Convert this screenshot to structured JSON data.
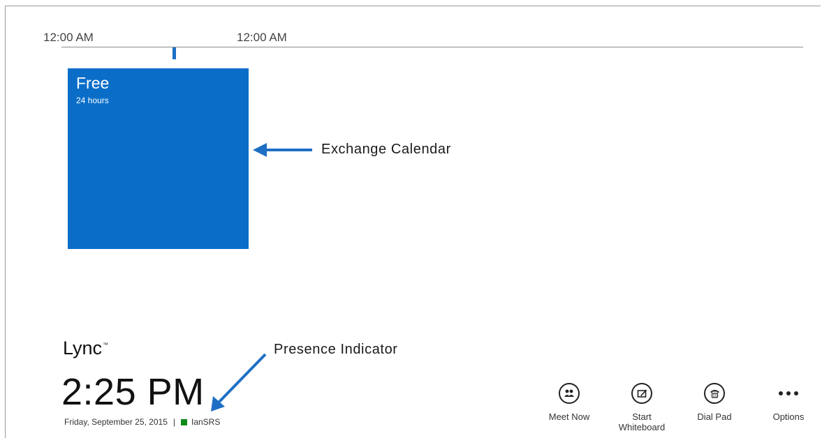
{
  "timeline": {
    "start_label": "12:00 AM",
    "end_label": "12:00 AM"
  },
  "calendar_tile": {
    "status": "Free",
    "duration": "24 hours",
    "color": "#0a6ec9"
  },
  "annotations": {
    "calendar_callout": "Exchange Calendar",
    "presence_callout": "Presence Indicator",
    "arrow_color": "#1e6fc4"
  },
  "brand": {
    "name": "Lync",
    "mark": "™"
  },
  "clock": {
    "time": "2:25 PM",
    "date": "Friday, September 25, 2015",
    "separator": "|",
    "user": "IanSRS",
    "presence_color": "#0d8a19"
  },
  "actions": [
    {
      "label": "Meet Now",
      "icon": "meet-now-icon"
    },
    {
      "label": "Start Whiteboard",
      "icon": "whiteboard-icon"
    },
    {
      "label": "Dial Pad",
      "icon": "dial-pad-icon"
    },
    {
      "label": "Options",
      "icon": "more-options-icon"
    }
  ]
}
